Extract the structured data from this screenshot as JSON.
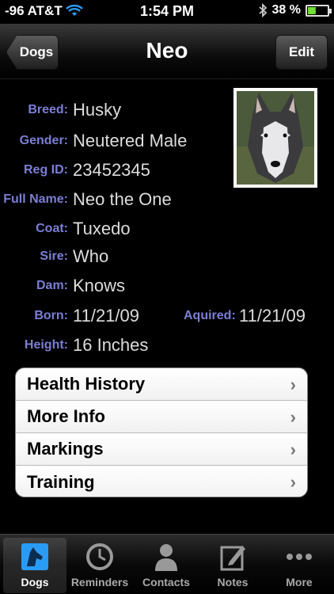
{
  "status": {
    "carrier": "-96 AT&T",
    "time": "1:54 PM",
    "battery": "38 %"
  },
  "nav": {
    "back_label": "Dogs",
    "title": "Neo",
    "edit_label": "Edit"
  },
  "details": {
    "breed": {
      "label": "Breed:",
      "value": "Husky"
    },
    "gender": {
      "label": "Gender:",
      "value": "Neutered Male"
    },
    "reg_id": {
      "label": "Reg ID:",
      "value": "23452345"
    },
    "full_name": {
      "label": "Full Name:",
      "value": "Neo the One"
    },
    "coat": {
      "label": "Coat:",
      "value": "Tuxedo"
    },
    "sire": {
      "label": "Sire:",
      "value": "Who"
    },
    "dam": {
      "label": "Dam:",
      "value": "Knows"
    },
    "born": {
      "label": "Born:",
      "value": "11/21/09"
    },
    "aquired": {
      "label": "Aquired:",
      "value": "11/21/09"
    },
    "height": {
      "label": "Height:",
      "value": "16 Inches"
    }
  },
  "menu": [
    {
      "label": "Health History"
    },
    {
      "label": "More Info"
    },
    {
      "label": "Markings"
    },
    {
      "label": "Training"
    }
  ],
  "tabs": [
    {
      "label": "Dogs",
      "icon": "dog-icon"
    },
    {
      "label": "Reminders",
      "icon": "clock-icon"
    },
    {
      "label": "Contacts",
      "icon": "person-icon"
    },
    {
      "label": "Notes",
      "icon": "note-icon"
    },
    {
      "label": "More",
      "icon": "more-icon"
    }
  ],
  "colors": {
    "label_blue": "#7b7fd6",
    "value_gray": "#dddddd",
    "battery_green": "#6ee03a",
    "active_tab": "#2a9bf5"
  }
}
